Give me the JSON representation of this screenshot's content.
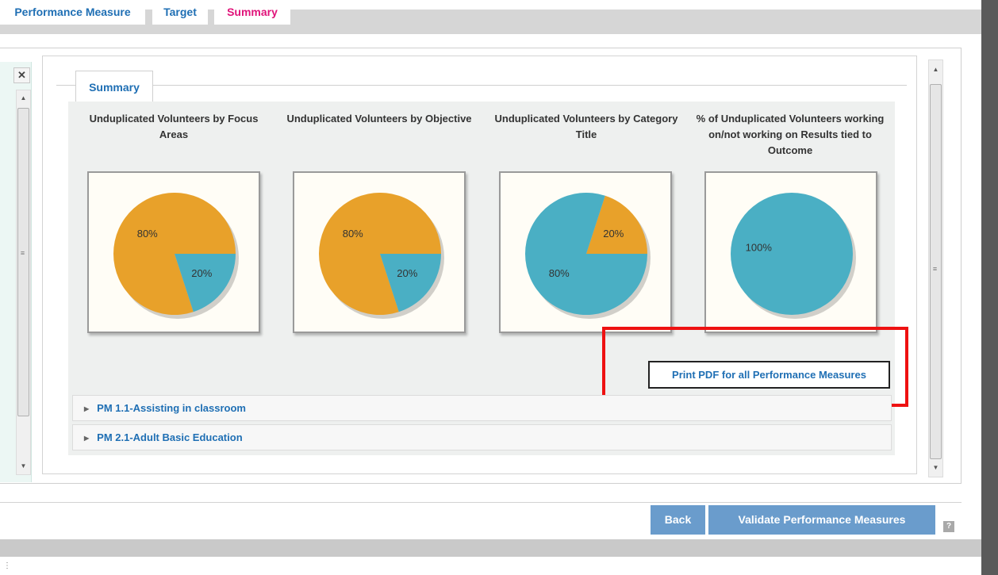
{
  "tabs": [
    {
      "label": "Performance Measure",
      "active": false
    },
    {
      "label": "Target",
      "active": false
    },
    {
      "label": "Summary",
      "active": true
    }
  ],
  "panel_tab": {
    "label": "Summary"
  },
  "charts": [
    {
      "title": "Unduplicated Volunteers by Focus Areas",
      "slices": [
        {
          "label": "80%",
          "value": 80,
          "color": "#e8a12a"
        },
        {
          "label": "20%",
          "value": 20,
          "color": "#4aafc4"
        }
      ]
    },
    {
      "title": "Unduplicated Volunteers by Objective",
      "slices": [
        {
          "label": "80%",
          "value": 80,
          "color": "#e8a12a"
        },
        {
          "label": "20%",
          "value": 20,
          "color": "#4aafc4"
        }
      ]
    },
    {
      "title": "Unduplicated Volunteers by Category Title",
      "slices": [
        {
          "label": "20%",
          "value": 20,
          "color": "#e8a12a"
        },
        {
          "label": "80%",
          "value": 80,
          "color": "#4aafc4"
        }
      ]
    },
    {
      "title": "% of Unduplicated Volunteers working on/not working on Results tied to Outcome",
      "slices": [
        {
          "label": "100%",
          "value": 100,
          "color": "#4aafc4"
        }
      ]
    }
  ],
  "print_button": {
    "label": "Print PDF for all Performance Measures"
  },
  "accordion": [
    {
      "label": "PM 1.1-Assisting in classroom"
    },
    {
      "label": "PM 2.1-Adult Basic Education"
    }
  ],
  "footer": {
    "back_label": "Back",
    "validate_label": "Validate Performance Measures",
    "help_glyph": "?"
  },
  "icons": {
    "close": "close-icon",
    "help": "help-icon"
  }
}
